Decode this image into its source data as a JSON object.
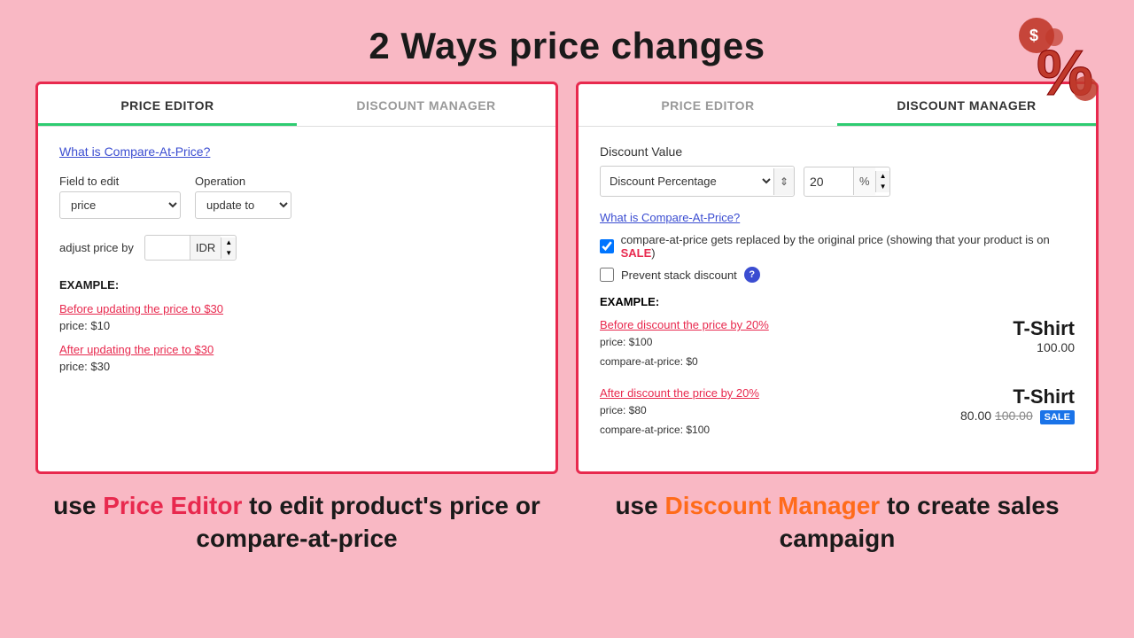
{
  "header": {
    "title": "2 Ways price changes"
  },
  "leftPanel": {
    "tabs": [
      {
        "id": "price-editor",
        "label": "PRICE EDITOR",
        "active": true
      },
      {
        "id": "discount-manager",
        "label": "DISCOUNT MANAGER",
        "active": false
      }
    ],
    "compareLink": "What is Compare-At-Price?",
    "fieldToEdit": {
      "label": "Field to edit",
      "value": "price"
    },
    "operation": {
      "label": "Operation",
      "value": "update to"
    },
    "adjustRow": {
      "label": "adjust price by",
      "currency": "IDR"
    },
    "example": {
      "title": "EXAMPLE:",
      "beforeLink": "Before updating the price to $30",
      "beforePrice": "price:  $10",
      "afterLink": "After updating the price to $30",
      "afterPrice": "price:  $30"
    }
  },
  "rightPanel": {
    "tabs": [
      {
        "id": "price-editor",
        "label": "PRICE EDITOR",
        "active": false
      },
      {
        "id": "discount-manager",
        "label": "DISCOUNT MANAGER",
        "active": true
      }
    ],
    "discountValueLabel": "Discount Value",
    "discountType": "Discount Percentage",
    "discountAmount": "20",
    "discountUnit": "%",
    "compareLink": "What is Compare-At-Price?",
    "checkboxes": [
      {
        "id": "compare-replace",
        "checked": true,
        "label": "compare-at-price gets replaced by the original price (showing that your product is on ",
        "saleText": "SALE",
        "suffix": ")"
      },
      {
        "id": "prevent-stack",
        "checked": false,
        "label": "Prevent stack discount",
        "hasHelp": true
      }
    ],
    "example": {
      "title": "EXAMPLE:",
      "beforeLink": "Before discount the price by 20%",
      "beforePriceLabel": "price:",
      "beforePriceValue": "$100",
      "beforeCompareLabel": "compare-at-price:",
      "beforeCompareValue": "$0",
      "beforeProductName": "T-Shirt",
      "beforeProductPrice": "100.00",
      "afterLink": "After discount the price by 20%",
      "afterPriceLabel": "price:",
      "afterPriceValue": "$80",
      "afterCompareLabel": "compare-at-price:",
      "afterCompareValue": "$100",
      "afterProductName": "T-Shirt",
      "afterPriceNew": "80.00",
      "afterPriceOld": "100.00",
      "saleBadge": "SALE"
    }
  },
  "footer": {
    "leftText1": "use ",
    "leftHighlight": "Price Editor",
    "leftText2": " to edit product's price or compare-at-price",
    "rightText1": "use ",
    "rightHighlight": "Discount Manager",
    "rightText2": " to create sales campaign"
  }
}
